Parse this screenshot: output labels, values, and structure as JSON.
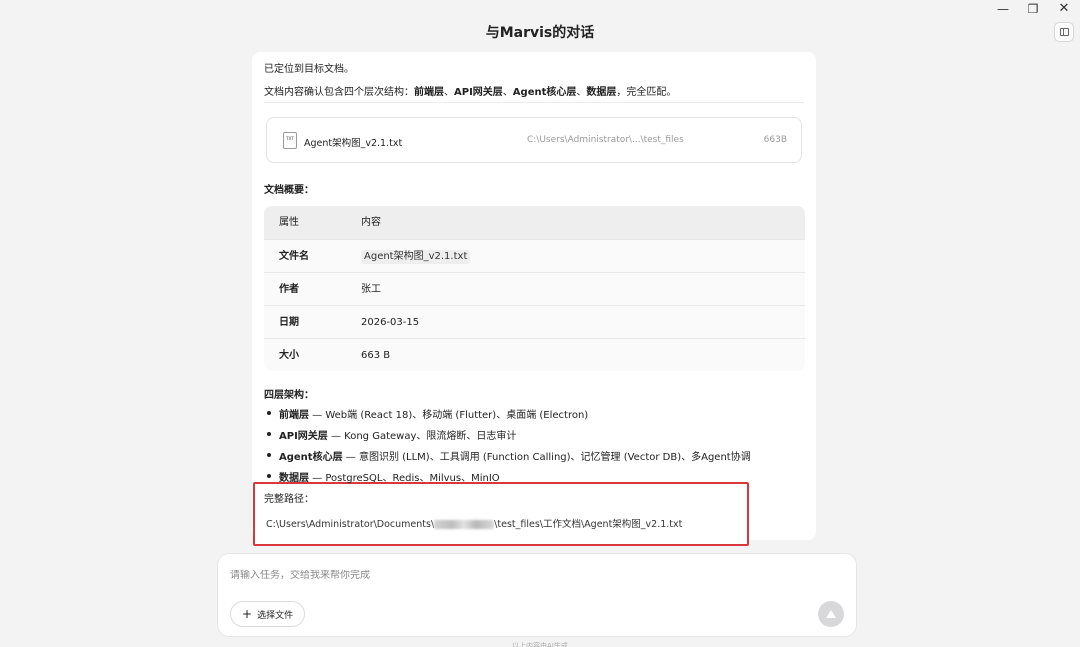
{
  "window": {
    "title": "与Marvis的对话",
    "minimize_glyph": "—",
    "maximize_glyph": "❐",
    "close_glyph": "✕"
  },
  "message": {
    "line1": "已定位到目标文档。",
    "line2_prefix": "文档内容确认包含四个层次结构：",
    "line2_layers": [
      "前端层",
      "API网关层",
      "Agent核心层",
      "数据层"
    ],
    "line2_sep": "、",
    "line2_suffix": "，完全匹配。"
  },
  "file_card": {
    "icon_text": "TXT",
    "name": "Agent架构图_v2.1.txt",
    "path": "C:\\Users\\Administrator\\...\\test_files",
    "size": "663B"
  },
  "summary": {
    "heading": "文档概要：",
    "columns": [
      "属性",
      "内容"
    ],
    "rows": [
      {
        "key": "文件名",
        "value": "Agent架构图_v2.1.txt"
      },
      {
        "key": "作者",
        "value": "张工"
      },
      {
        "key": "日期",
        "value": "2026-03-15"
      },
      {
        "key": "大小",
        "value": "663 B"
      }
    ]
  },
  "architecture": {
    "heading": "四层架构：",
    "items": [
      {
        "name": "前端层",
        "desc": " — Web端 (React 18)、移动端 (Flutter)、桌面端 (Electron)"
      },
      {
        "name": "API网关层",
        "desc": " — Kong Gateway、限流熔断、日志审计"
      },
      {
        "name": "Agent核心层",
        "desc": " — 意图识别 (LLM)、工具调用 (Function Calling)、记忆管理 (Vector DB)、多Agent协调"
      },
      {
        "name": "数据层",
        "desc": " — PostgreSQL、Redis、Milvus、MinIO"
      }
    ]
  },
  "full_path": {
    "heading": "完整路径：",
    "before": "C:\\Users\\Administrator\\Documents\\",
    "after": "\\test_files\\工作文档\\Agent架构图_v2.1.txt"
  },
  "composer": {
    "placeholder": "请输入任务，交给我来帮你完成",
    "attach_label": "选择文件",
    "footer": "以上内容由AI生成"
  },
  "colors": {
    "highlight_border": "#d9373b",
    "background": "#f3f3f4"
  },
  "icons": {
    "file": "txt-file-icon",
    "send": "arrow-up-icon",
    "attach": "plus-icon",
    "sidebar": "sidebar-toggle-icon"
  }
}
